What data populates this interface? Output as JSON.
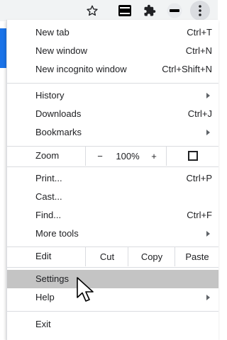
{
  "menu": {
    "groups": [
      {
        "items": [
          {
            "label": "New tab",
            "shortcut": "Ctrl+T"
          },
          {
            "label": "New window",
            "shortcut": "Ctrl+N"
          },
          {
            "label": "New incognito window",
            "shortcut": "Ctrl+Shift+N"
          }
        ]
      },
      {
        "items": [
          {
            "label": "History"
          },
          {
            "label": "Downloads",
            "shortcut": "Ctrl+J"
          },
          {
            "label": "Bookmarks"
          }
        ]
      },
      {
        "zoom": {
          "label": "Zoom",
          "minus": "−",
          "value": "100%",
          "plus": "+"
        }
      },
      {
        "items": [
          {
            "label": "Print...",
            "shortcut": "Ctrl+P"
          },
          {
            "label": "Cast..."
          },
          {
            "label": "Find...",
            "shortcut": "Ctrl+F"
          },
          {
            "label": "More tools"
          }
        ]
      },
      {
        "edit": {
          "label": "Edit",
          "cut": "Cut",
          "copy": "Copy",
          "paste": "Paste"
        }
      },
      {
        "items": [
          {
            "label": "Settings"
          },
          {
            "label": "Help"
          }
        ]
      },
      {
        "items": [
          {
            "label": "Exit"
          }
        ]
      }
    ],
    "highlighted_item": "Settings"
  },
  "colors": {
    "accent": "#1a73e8",
    "highlight": "#c4c4c4",
    "toolbar": "#f1f3f4"
  }
}
